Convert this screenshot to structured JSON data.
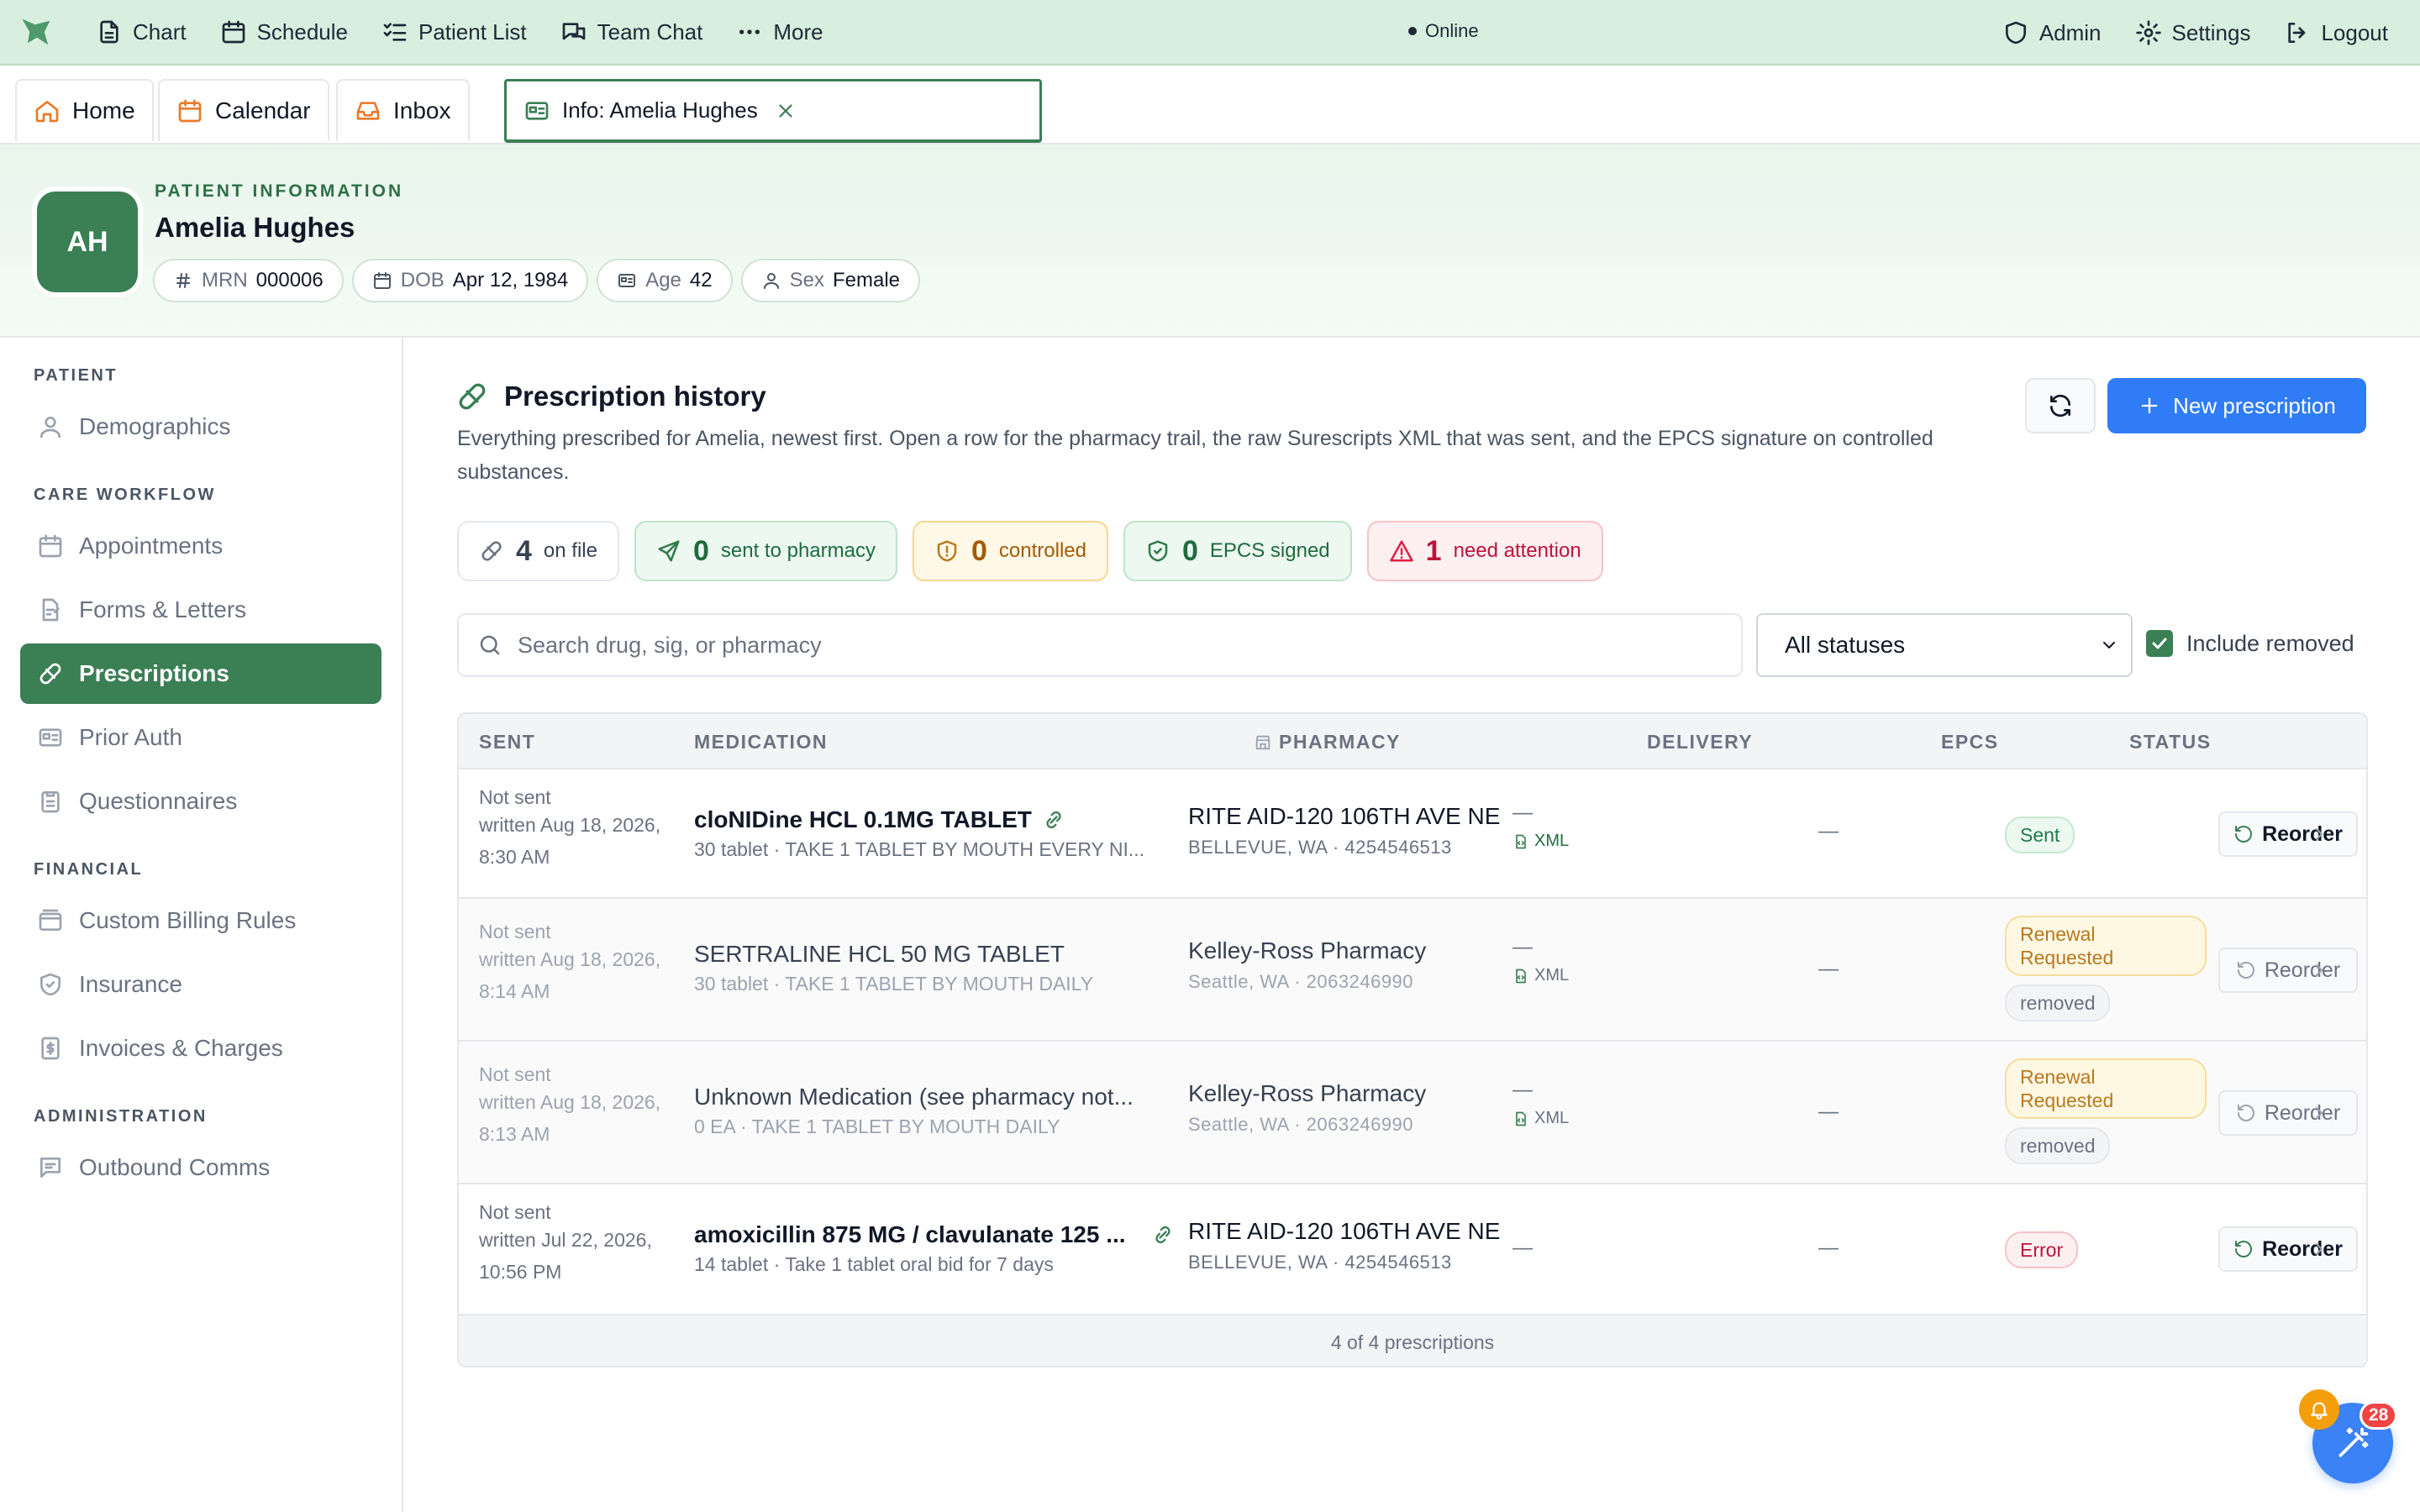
{
  "topbar": {
    "nav": [
      {
        "label": "Chart",
        "icon": "document-icon"
      },
      {
        "label": "Schedule",
        "icon": "calendar-icon"
      },
      {
        "label": "Patient List",
        "icon": "list-check-icon"
      },
      {
        "label": "Team Chat",
        "icon": "chat-icon"
      },
      {
        "label": "More",
        "icon": "dots-icon"
      }
    ],
    "status": "Online",
    "right": [
      {
        "label": "Admin",
        "icon": "shield-icon"
      },
      {
        "label": "Settings",
        "icon": "gear-icon"
      },
      {
        "label": "Logout",
        "icon": "logout-icon"
      }
    ]
  },
  "tabs": [
    {
      "label": "Home",
      "icon": "home-icon"
    },
    {
      "label": "Calendar",
      "icon": "calendar-icon"
    },
    {
      "label": "Inbox",
      "icon": "inbox-icon"
    },
    {
      "label": "Info: Amelia Hughes",
      "icon": "id-card-icon",
      "active": true
    }
  ],
  "patient": {
    "kicker": "PATIENT INFORMATION",
    "initials": "AH",
    "name": "Amelia Hughes",
    "chips": [
      {
        "key": "MRN",
        "value": "000006",
        "icon": "hash-icon"
      },
      {
        "key": "DOB",
        "value": "Apr 12, 1984",
        "icon": "calendar-icon"
      },
      {
        "key": "Age",
        "value": "42",
        "icon": "id-card-icon"
      },
      {
        "key": "Sex",
        "value": "Female",
        "icon": "user-icon"
      }
    ]
  },
  "sidebar": {
    "sections": [
      "PATIENT",
      "CARE WORKFLOW",
      "FINANCIAL",
      "ADMINISTRATION"
    ],
    "items": [
      {
        "label": "Demographics",
        "icon": "user-icon"
      },
      {
        "label": "Appointments",
        "icon": "calendar-icon"
      },
      {
        "label": "Forms & Letters",
        "icon": "form-icon"
      },
      {
        "label": "Prescriptions",
        "icon": "pill-icon",
        "active": true
      },
      {
        "label": "Prior Auth",
        "icon": "id-card-icon"
      },
      {
        "label": "Questionnaires",
        "icon": "clipboard-icon"
      },
      {
        "label": "Custom Billing Rules",
        "icon": "wallet-icon"
      },
      {
        "label": "Insurance",
        "icon": "shield-check-icon"
      },
      {
        "label": "Invoices & Charges",
        "icon": "invoice-icon"
      },
      {
        "label": "Outbound Comms",
        "icon": "message-icon"
      }
    ]
  },
  "main": {
    "title": "Prescription history",
    "description": "Everything prescribed for Amelia, newest first. Open a row for the pharmacy trail, the raw Surescripts XML that was sent, and the EPCS signature on controlled substances.",
    "new_button": "New prescription",
    "stats": [
      {
        "count": "4",
        "label": "on file"
      },
      {
        "count": "0",
        "label": "sent to pharmacy"
      },
      {
        "count": "0",
        "label": "controlled"
      },
      {
        "count": "0",
        "label": "EPCS signed"
      },
      {
        "count": "1",
        "label": "need attention"
      }
    ],
    "search_placeholder": "Search drug, sig, or pharmacy",
    "status_filter": "All statuses",
    "include_removed": "Include removed",
    "columns": [
      "SENT",
      "MEDICATION",
      "PHARMACY",
      "DELIVERY",
      "EPCS",
      "STATUS"
    ],
    "rows": [
      {
        "sent": "Not sent",
        "written": "written Aug 18, 2026, 8:30 AM",
        "med": "cloNIDine HCL 0.1MG TABLET",
        "sig": "30 tablet · TAKE 1 TABLET BY MOUTH EVERY NI...",
        "pharmacy": "RITE AID-120 106TH AVE NE",
        "pharmacy_addr": "BELLEVUE, WA · 4254546513",
        "dash": "—",
        "xml": "XML",
        "delivery": "—",
        "epcs": "",
        "status": "Sent",
        "removed": "",
        "action": "Reorder"
      },
      {
        "sent": "Not sent",
        "written": "written Aug 18, 2026, 8:14 AM",
        "med": "SERTRALINE HCL 50 MG TABLET",
        "sig": "30 tablet · TAKE 1 TABLET BY MOUTH DAILY",
        "pharmacy": "Kelley-Ross Pharmacy",
        "pharmacy_addr": "Seattle, WA · 2063246990",
        "dash": "—",
        "xml": "XML",
        "delivery": "—",
        "epcs": "",
        "status": "Renewal Requested",
        "removed": "removed",
        "action": "Reorder"
      },
      {
        "sent": "Not sent",
        "written": "written Aug 18, 2026, 8:13 AM",
        "med": "Unknown Medication (see pharmacy not...",
        "sig": "0 EA · TAKE 1 TABLET BY MOUTH DAILY",
        "pharmacy": "Kelley-Ross Pharmacy",
        "pharmacy_addr": "Seattle, WA · 2063246990",
        "dash": "—",
        "xml": "XML",
        "delivery": "—",
        "epcs": "",
        "status": "Renewal Requested",
        "removed": "removed",
        "action": "Reorder"
      },
      {
        "sent": "Not sent",
        "written": "written Jul 22, 2026, 10:56 PM",
        "med": "amoxicillin 875 MG / clavulanate 125 ...",
        "sig": "14 tablet · Take 1 tablet oral bid for 7 days",
        "pharmacy": "RITE AID-120 106TH AVE NE",
        "pharmacy_addr": "BELLEVUE, WA · 4254546513",
        "dash": "—",
        "xml": "",
        "delivery": "—",
        "epcs": "",
        "status": "Error",
        "removed": "",
        "action": "Reorder"
      }
    ],
    "footer": "4 of 4 prescriptions"
  },
  "floating": {
    "badge_count": "28"
  }
}
